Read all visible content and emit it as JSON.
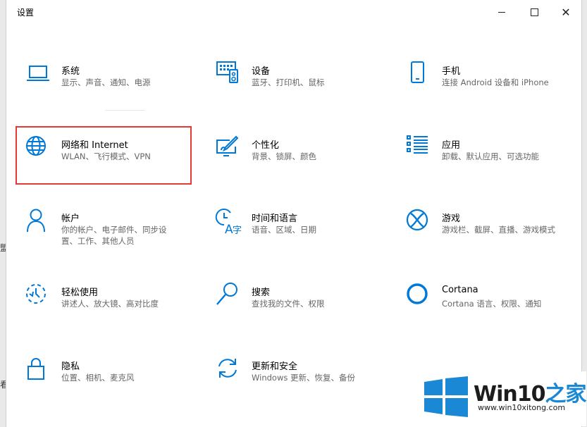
{
  "window": {
    "title": "设置",
    "minimize_label": "",
    "maximize_label": "",
    "close_label": "✕"
  },
  "accent_color": "#0078d7",
  "highlight_color": "#e53935",
  "settings_items": [
    {
      "name": "系统",
      "desc": "显示、声音、通知、电源",
      "icon": "laptop-icon"
    },
    {
      "name": "设备",
      "desc": "蓝牙、打印机、鼠标",
      "icon": "devices-icon"
    },
    {
      "name": "手机",
      "desc": "连接 Android 设备和 iPhone",
      "icon": "phone-icon"
    },
    {
      "name": "网络和 Internet",
      "desc": "WLAN、飞行模式、VPN",
      "icon": "globe-icon"
    },
    {
      "name": "个性化",
      "desc": "背景、锁屏、颜色",
      "icon": "personalization-icon"
    },
    {
      "name": "应用",
      "desc": "卸载、默认应用、可选功能",
      "icon": "apps-list-icon"
    },
    {
      "name": "帐户",
      "desc": "你的帐户、电子邮件、同步设置、工作、其他人员",
      "icon": "person-icon"
    },
    {
      "name": "时间和语言",
      "desc": "语音、区域、日期",
      "icon": "time-language-icon"
    },
    {
      "name": "游戏",
      "desc": "游戏栏、截屏、直播、游戏模式",
      "icon": "xbox-icon"
    },
    {
      "name": "轻松使用",
      "desc": "讲述人、放大镜、高对比度",
      "icon": "ease-of-access-icon"
    },
    {
      "name": "搜索",
      "desc": "查找我的文件、权限",
      "icon": "search-icon"
    },
    {
      "name": "Cortana",
      "desc": "Cortana 语言、权限、通知",
      "icon": "cortana-icon"
    },
    {
      "name": "隐私",
      "desc": "位置、相机、麦克风",
      "icon": "lock-icon"
    },
    {
      "name": "更新和安全",
      "desc": "Windows 更新、恢复、备份",
      "icon": "update-sync-icon"
    }
  ],
  "edge_fragments": [
    "盟",
    "看"
  ],
  "watermark": {
    "title_prefix": "Win10",
    "title_suffix": "之家",
    "url": "www.win10xitong.com"
  }
}
